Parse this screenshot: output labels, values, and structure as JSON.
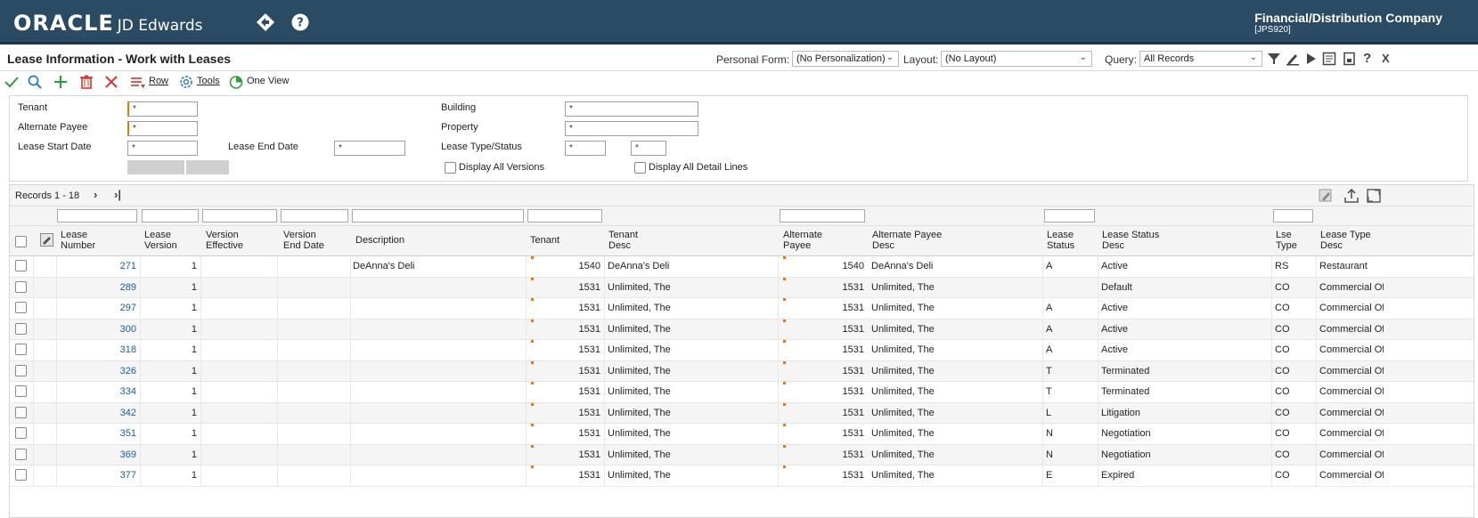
{
  "header": {
    "logo_oracle": "ORACLE",
    "logo_jde": "JD Edwards",
    "company_name": "Financial/Distribution Company",
    "company_env": "[JPS920]"
  },
  "title": {
    "page_title": "Lease Information - Work with Leases",
    "personal_form_label": "Personal Form:",
    "personal_form_value": "(No Personalization)",
    "layout_label": "Layout:",
    "layout_value": "(No Layout)",
    "query_label": "Query:",
    "query_value": "All Records",
    "close_label": "X"
  },
  "toolbar": {
    "row_label": "Row",
    "tools_label": "Tools",
    "oneview_label": "One View"
  },
  "filters": {
    "tenant_label": "Tenant",
    "tenant_value": "*",
    "alt_payee_label": "Alternate Payee",
    "alt_payee_value": "*",
    "lease_start_label": "Lease Start Date",
    "lease_start_value": "*",
    "lease_end_label": "Lease End Date",
    "lease_end_value": "*",
    "building_label": "Building",
    "building_value": "*",
    "property_label": "Property",
    "property_value": "*",
    "lease_type_status_label": "Lease Type/Status",
    "lease_type_value": "*",
    "lease_status_value": "*",
    "display_all_versions": "Display All Versions",
    "display_all_detail_lines": "Display All Detail Lines"
  },
  "grid": {
    "records_label": "Records 1 - 18",
    "columns": {
      "lease_number": "Lease\nNumber",
      "lease_version": "Lease\nVersion",
      "version_effective": "Version\nEffective",
      "version_end_date": "Version\nEnd Date",
      "description": "Description",
      "tenant": "Tenant",
      "tenant_desc": "Tenant\nDesc",
      "alternate_payee": "Alternate\nPayee",
      "alternate_payee_desc": "Alternate Payee\nDesc",
      "lease_status": "Lease\nStatus",
      "lease_status_desc": "Lease Status\nDesc",
      "lse_type": "Lse\nType",
      "lease_type_desc": "Lease Type\nDesc"
    },
    "rows": [
      {
        "lease": "271",
        "version": "1",
        "description": "DeAnna's Deli",
        "tenant": "1540",
        "tenant_desc": "DeAnna's Deli",
        "payee": "1540",
        "payee_desc": "DeAnna's Deli",
        "status": "A",
        "status_desc": "Active",
        "type": "RS",
        "type_desc": "Restaurant"
      },
      {
        "lease": "289",
        "version": "1",
        "description": "",
        "tenant": "1531",
        "tenant_desc": "Unlimited, The",
        "payee": "1531",
        "payee_desc": "Unlimited, The",
        "status": "",
        "status_desc": "Default",
        "type": "CO",
        "type_desc": "Commercial Offi"
      },
      {
        "lease": "297",
        "version": "1",
        "description": "",
        "tenant": "1531",
        "tenant_desc": "Unlimited, The",
        "payee": "1531",
        "payee_desc": "Unlimited, The",
        "status": "A",
        "status_desc": "Active",
        "type": "CO",
        "type_desc": "Commercial Offi"
      },
      {
        "lease": "300",
        "version": "1",
        "description": "",
        "tenant": "1531",
        "tenant_desc": "Unlimited, The",
        "payee": "1531",
        "payee_desc": "Unlimited, The",
        "status": "A",
        "status_desc": "Active",
        "type": "CO",
        "type_desc": "Commercial Offi"
      },
      {
        "lease": "318",
        "version": "1",
        "description": "",
        "tenant": "1531",
        "tenant_desc": "Unlimited, The",
        "payee": "1531",
        "payee_desc": "Unlimited, The",
        "status": "A",
        "status_desc": "Active",
        "type": "CO",
        "type_desc": "Commercial Offi"
      },
      {
        "lease": "326",
        "version": "1",
        "description": "",
        "tenant": "1531",
        "tenant_desc": "Unlimited, The",
        "payee": "1531",
        "payee_desc": "Unlimited, The",
        "status": "T",
        "status_desc": "Terminated",
        "type": "CO",
        "type_desc": "Commercial Offi"
      },
      {
        "lease": "334",
        "version": "1",
        "description": "",
        "tenant": "1531",
        "tenant_desc": "Unlimited, The",
        "payee": "1531",
        "payee_desc": "Unlimited, The",
        "status": "T",
        "status_desc": "Terminated",
        "type": "CO",
        "type_desc": "Commercial Offi"
      },
      {
        "lease": "342",
        "version": "1",
        "description": "",
        "tenant": "1531",
        "tenant_desc": "Unlimited, The",
        "payee": "1531",
        "payee_desc": "Unlimited, The",
        "status": "L",
        "status_desc": "Litigation",
        "type": "CO",
        "type_desc": "Commercial Offi"
      },
      {
        "lease": "351",
        "version": "1",
        "description": "",
        "tenant": "1531",
        "tenant_desc": "Unlimited, The",
        "payee": "1531",
        "payee_desc": "Unlimited, The",
        "status": "N",
        "status_desc": "Negotiation",
        "type": "CO",
        "type_desc": "Commercial Offi"
      },
      {
        "lease": "369",
        "version": "1",
        "description": "",
        "tenant": "1531",
        "tenant_desc": "Unlimited, The",
        "payee": "1531",
        "payee_desc": "Unlimited, The",
        "status": "N",
        "status_desc": "Negotiation",
        "type": "CO",
        "type_desc": "Commercial Offi"
      },
      {
        "lease": "377",
        "version": "1",
        "description": "",
        "tenant": "1531",
        "tenant_desc": "Unlimited, The",
        "payee": "1531",
        "payee_desc": "Unlimited, The",
        "status": "E",
        "status_desc": "Expired",
        "type": "CO",
        "type_desc": "Commercial Offi"
      }
    ]
  },
  "colors": {
    "header_bg": "#2b4a63",
    "link": "#1b5aa3",
    "required_marker": "#e8750c",
    "ok_green": "#2e9e3e",
    "delete_red": "#d9342b"
  },
  "icons": [
    "back-diamond-icon",
    "help-icon",
    "filter-icon",
    "edit-icon",
    "play-icon",
    "notes-icon",
    "export-icon",
    "help-question-icon",
    "check-icon",
    "search-icon",
    "add-icon",
    "trash-icon",
    "cancel-icon",
    "row-menu-icon",
    "tools-gear-icon",
    "oneview-icon",
    "next-page-icon",
    "last-page-icon",
    "grid-personalize-icon",
    "grid-export-icon",
    "grid-maximize-icon"
  ]
}
